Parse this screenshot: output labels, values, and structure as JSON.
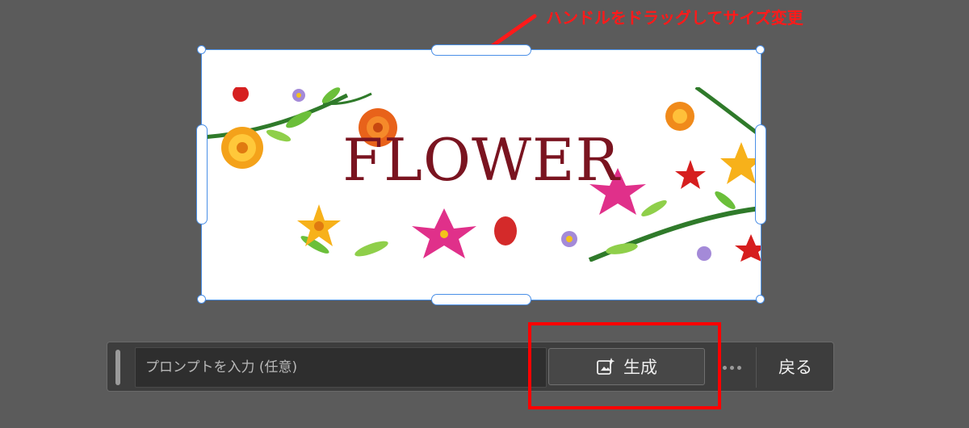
{
  "annotation": {
    "text": "ハンドルをドラッグしてサイズ変更",
    "color": "#ff1a1a"
  },
  "canvas": {
    "image_title": "FLOWER",
    "selection_color": "#4a8fe7",
    "title_color": "#7a1420"
  },
  "taskbar": {
    "prompt_placeholder": "プロンプトを入力 (任意)",
    "generate_label": "生成",
    "generate_icon": "sparkle-image-icon",
    "more_icon": "more-dots-icon",
    "back_label": "戻る"
  },
  "highlight": {
    "color": "#ff0000"
  }
}
